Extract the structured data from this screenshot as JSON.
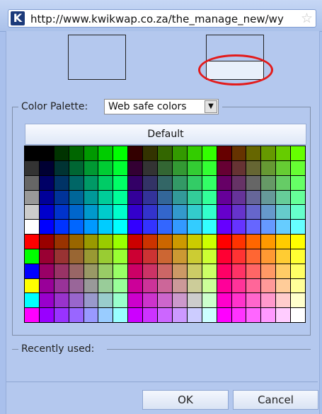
{
  "browser": {
    "url": "http://www.kwikwap.co.za/the_manage_new/wy",
    "site_icon_glyph": "K",
    "favorite_icon": "star-outline-icon"
  },
  "palette": {
    "legend": "Color Palette:",
    "selected": "Web safe colors",
    "default_label": "Default"
  },
  "recent": {
    "legend": "Recently used:"
  },
  "buttons": {
    "ok": "OK",
    "cancel": "Cancel"
  },
  "highlight_color": "#e31b1b",
  "swatch_grid": {
    "rows": 12,
    "cols": 19,
    "left_column": [
      "#000000",
      "#333333",
      "#666666",
      "#999999",
      "#cccccc",
      "#ffffff",
      "#ff0000",
      "#00ff00",
      "#0000ff",
      "#ffff00",
      "#00ffff",
      "#ff00ff"
    ],
    "levels": [
      "00",
      "33",
      "66",
      "99",
      "cc",
      "ff"
    ]
  }
}
